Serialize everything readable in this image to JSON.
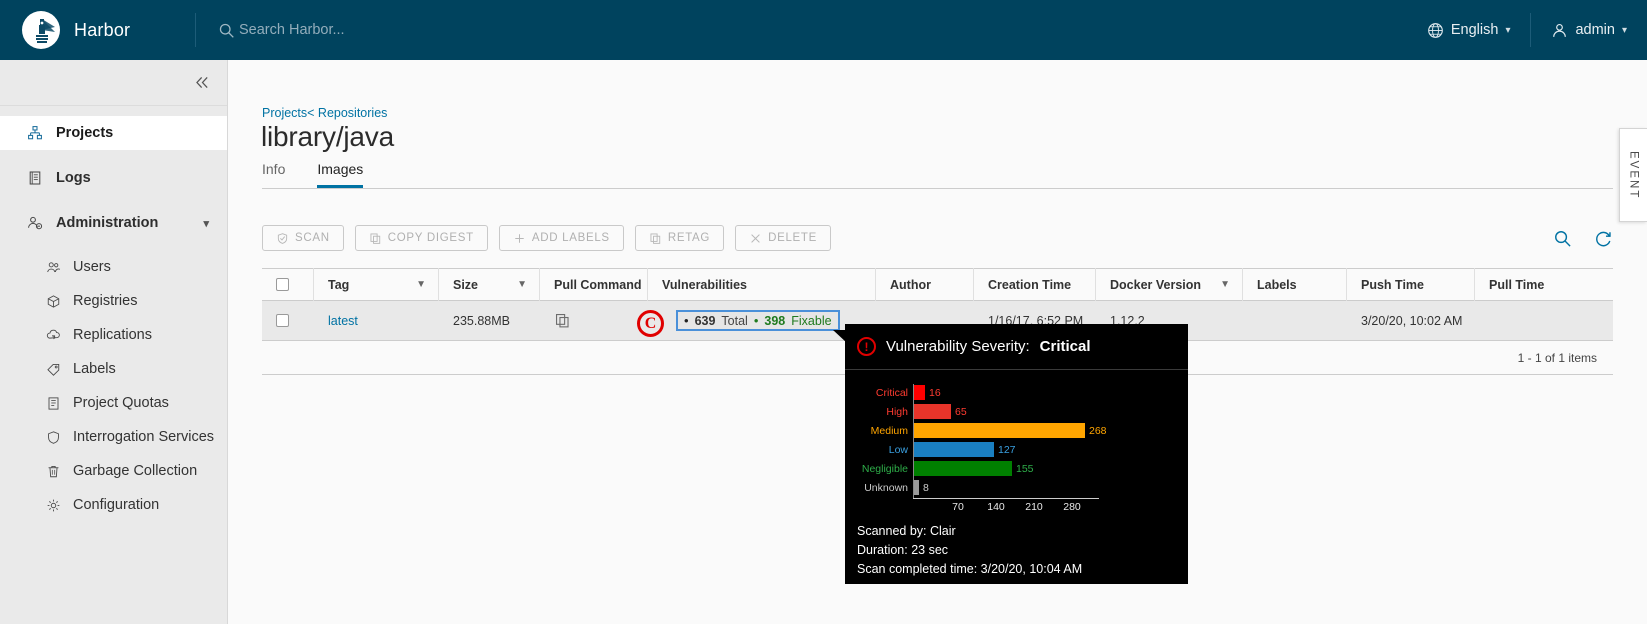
{
  "header": {
    "brand": "Harbor",
    "search_placeholder": "Search Harbor...",
    "language": "English",
    "user": "admin",
    "globe_icon": "globe-icon",
    "user_icon": "user-icon",
    "search_icon": "search-icon"
  },
  "sidebar": {
    "collapse_icon": "collapse-double-chevron-icon",
    "items": [
      {
        "label": "Projects",
        "icon": "projects-icon",
        "active": true
      },
      {
        "label": "Logs",
        "icon": "logs-icon",
        "active": false
      },
      {
        "label": "Administration",
        "icon": "administration-icon",
        "active": false,
        "expanded": true
      }
    ],
    "admin_items": [
      {
        "label": "Users",
        "icon": "users-icon"
      },
      {
        "label": "Registries",
        "icon": "registries-icon"
      },
      {
        "label": "Replications",
        "icon": "replications-icon"
      },
      {
        "label": "Labels",
        "icon": "labels-icon"
      },
      {
        "label": "Project Quotas",
        "icon": "project-quotas-icon"
      },
      {
        "label": "Interrogation Services",
        "icon": "shield-icon"
      },
      {
        "label": "Garbage Collection",
        "icon": "trash-icon"
      },
      {
        "label": "Configuration",
        "icon": "gear-icon"
      }
    ]
  },
  "main": {
    "breadcrumb": "Projects< Repositories",
    "title": "library/java",
    "tabs": [
      {
        "label": "Info",
        "active": false
      },
      {
        "label": "Images",
        "active": true
      }
    ],
    "toolbar": {
      "scan": "SCAN",
      "copy_digest": "COPY DIGEST",
      "add_labels": "ADD LABELS",
      "retag": "RETAG",
      "delete": "DELETE",
      "search_icon": "search-icon",
      "refresh_icon": "refresh-icon"
    },
    "table": {
      "columns": [
        "Tag",
        "Size",
        "Pull Command",
        "Vulnerabilities",
        "Author",
        "Creation Time",
        "Docker Version",
        "Labels",
        "Push Time",
        "Pull Time"
      ],
      "rows": [
        {
          "tag": "latest",
          "size": "235.88MB",
          "pull_command": "copy-icon",
          "vuln_total_count": "639",
          "vuln_total_label": "Total",
          "vuln_fixable_count": "398",
          "vuln_fixable_label": "Fixable",
          "author": "",
          "creation_time": "1/16/17, 6:52 PM",
          "docker_version": "1.12.2",
          "labels": "",
          "push_time": "3/20/20, 10:02 AM",
          "pull_time": ""
        }
      ],
      "footer": "1 - 1 of 1 items"
    }
  },
  "event_tab": {
    "label": "EVENT"
  },
  "annotation": {
    "marker": "C",
    "color": "#e00000"
  },
  "tooltip": {
    "title_prefix": "Vulnerability Severity:",
    "severity": "Critical",
    "warn_icon": "warning-icon",
    "scanned_by": "Scanned by: Clair",
    "duration": "Duration: 23 sec",
    "completed": "Scan completed time: 3/20/20, 10:04 AM"
  },
  "chart_data": {
    "type": "bar",
    "orientation": "horizontal",
    "title": "Vulnerability Severity: Critical",
    "categories": [
      "Critical",
      "High",
      "Medium",
      "Low",
      "Negligible",
      "Unknown"
    ],
    "values": [
      16,
      65,
      268,
      127,
      155,
      8
    ],
    "colors": [
      "#ff0000",
      "#e8342a",
      "#ffa500",
      "#1a7fc1",
      "#008000",
      "#9a9a9a"
    ],
    "label_colors": [
      "#ff3b30",
      "#ff3b30",
      "#ffa500",
      "#3aa0e0",
      "#2eae49",
      "#cccccc"
    ],
    "xticks": [
      70,
      140,
      210,
      280
    ],
    "xlim": [
      0,
      300
    ],
    "xlabel": "",
    "ylabel": "",
    "grid": false,
    "legend": false
  }
}
